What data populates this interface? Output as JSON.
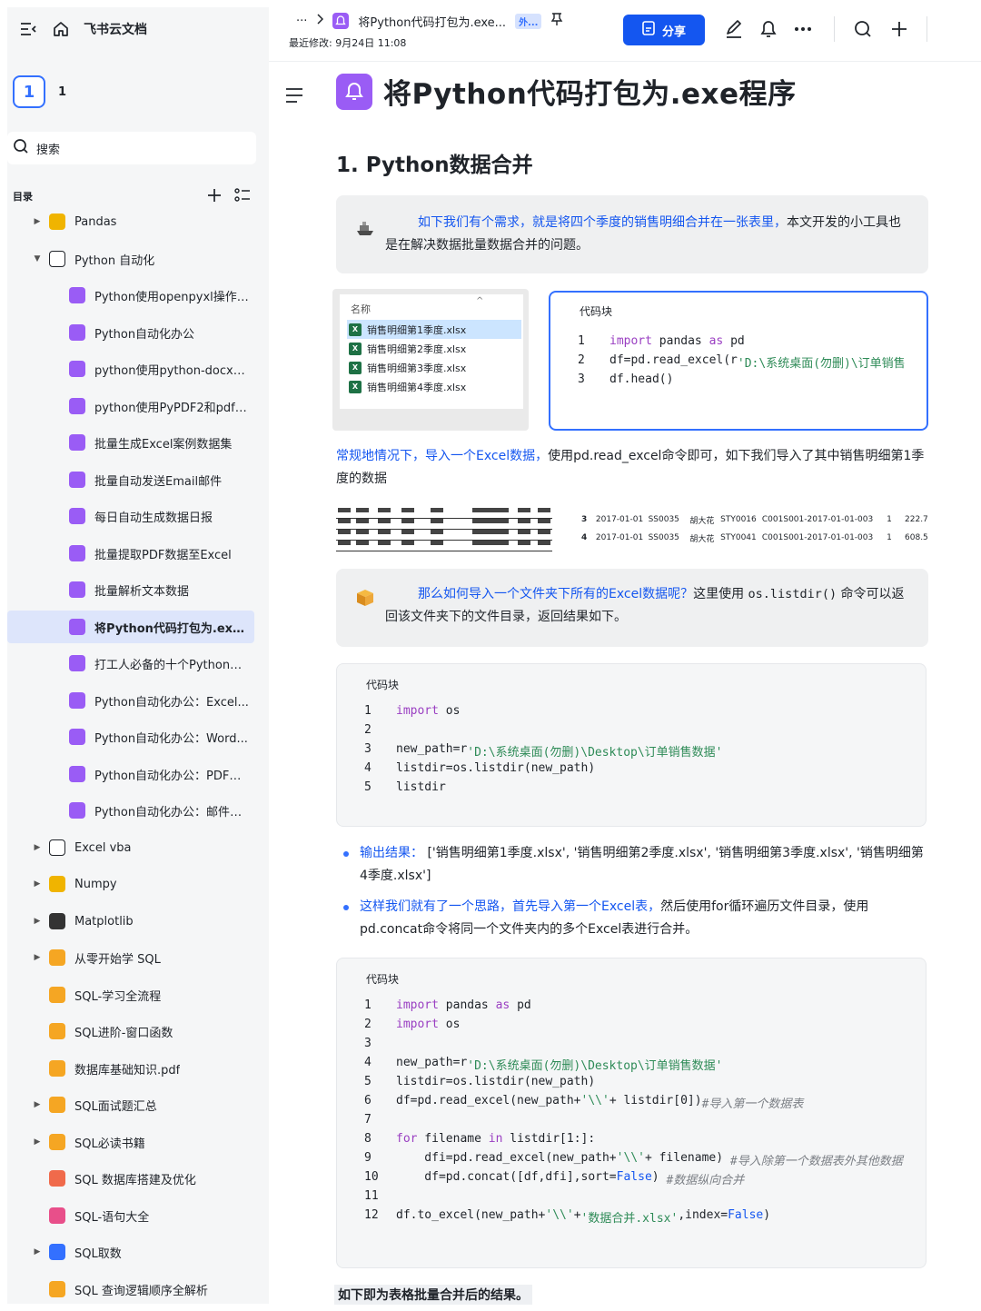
{
  "sidebar": {
    "brand": "飞书云文档",
    "user_badge": "1",
    "user_name": "1",
    "search_label": "搜索",
    "toc_label": "目录",
    "items": [
      {
        "label": "Pandas",
        "arrow": "right",
        "icon_color": "#f0b400"
      },
      {
        "label": "Python 自动化",
        "arrow": "down",
        "icon_color": "#ffffff"
      },
      {
        "label": "Python使用openpyxl操作e...",
        "icon_color": "#9a5cf5"
      },
      {
        "label": "Python自动化办公",
        "icon_color": "#9a5cf5"
      },
      {
        "label": "python使用python-docx操...",
        "icon_color": "#9a5cf5"
      },
      {
        "label": "python使用PyPDF2和pdfpl...",
        "icon_color": "#9a5cf5"
      },
      {
        "label": "批量生成Excel案例数据集",
        "icon_color": "#9a5cf5"
      },
      {
        "label": "批量自动发送Email邮件",
        "icon_color": "#9a5cf5"
      },
      {
        "label": "每日自动生成数据日报",
        "icon_color": "#9a5cf5"
      },
      {
        "label": "批量提取PDF数据至Excel",
        "icon_color": "#9a5cf5"
      },
      {
        "label": "批量解析文本数据",
        "icon_color": "#9a5cf5"
      },
      {
        "label": "将Python代码打包为.exe程序",
        "icon_color": "#9a5cf5",
        "active": true
      },
      {
        "label": "打工人必备的十个Python自...",
        "icon_color": "#9a5cf5"
      },
      {
        "label": "Python自动化办公：Excel...",
        "icon_color": "#9a5cf5"
      },
      {
        "label": "Python自动化办公：Word...",
        "icon_color": "#9a5cf5"
      },
      {
        "label": "Python自动化办公：PDF自...",
        "icon_color": "#9a5cf5"
      },
      {
        "label": "Python自动化办公：邮件自...",
        "icon_color": "#9a5cf5"
      },
      {
        "label": "Excel vba",
        "arrow": "right",
        "icon_color": "#ffffff"
      },
      {
        "label": "Numpy",
        "arrow": "right",
        "icon_color": "#f0b400"
      },
      {
        "label": "Matplotlib",
        "arrow": "right",
        "icon_color": "#333333"
      },
      {
        "label": "从零开始学 SQL",
        "arrow": "right",
        "icon_color": "#f5a623"
      },
      {
        "label": "SQL-学习全流程",
        "icon_color": "#f5a623"
      },
      {
        "label": "SQL进阶-窗口函数",
        "icon_color": "#f5a623"
      },
      {
        "label": "数据库基础知识.pdf",
        "icon_color": "#f5a623"
      },
      {
        "label": "SQL面试题汇总",
        "arrow": "right",
        "icon_color": "#f5a623"
      },
      {
        "label": "SQL必读书籍",
        "arrow": "right",
        "icon_color": "#f5a623"
      },
      {
        "label": "SQL 数据库搭建及优化",
        "icon_color": "#f06a4b"
      },
      {
        "label": "SQL-语句大全",
        "icon_color": "#e84f8a"
      },
      {
        "label": "SQL取数",
        "arrow": "right",
        "icon_color": "#3370ff"
      },
      {
        "label": "SQL 查询逻辑顺序全解析",
        "icon_color": "#f5a623"
      }
    ]
  },
  "topbar": {
    "ellipsis": "···",
    "doc_name": "将Python代码打包为.exe...",
    "tag": "外...",
    "modified": "最近修改: 9月24日 11:08",
    "share_label": "分享"
  },
  "doc": {
    "title": "将Python代码打包为.exe程序",
    "h2": "1. Python数据合并",
    "callout1_blue": "如下我们有个需求，就是将四个季度的销售明细合并在一张表里，",
    "callout1_rest": "本文开发的小工具也是在解决数据批量数据合并的问题。",
    "explorer": {
      "header": "名称",
      "files": [
        "销售明细第1季度.xlsx",
        "销售明细第2季度.xlsx",
        "销售明细第3季度.xlsx",
        "销售明细第4季度.xlsx"
      ]
    },
    "code1": {
      "label": "代码块",
      "lines": [
        {
          "n": "1",
          "parts": [
            {
              "t": "import",
              "c": "kw"
            },
            {
              "t": " pandas "
            },
            {
              "t": "as",
              "c": "kw"
            },
            {
              "t": " pd"
            }
          ]
        },
        {
          "n": "2",
          "parts": [
            {
              "t": "df=pd.read_excel(r"
            },
            {
              "t": "'D:\\系统桌面(勿删)\\订单销售",
              "c": "str"
            }
          ]
        },
        {
          "n": "3",
          "parts": [
            {
              "t": "df.head()"
            }
          ]
        }
      ]
    },
    "para1_blue": "常规地情况下，导入一个Excel数据，",
    "para1_rest": "使用pd.read_excel命令即可，如下我们导入了其中销售明细第1季度的数据",
    "snip_rows": [
      [
        "3",
        "2017-01-01",
        "SS0035",
        "胡大花",
        "STY0016",
        "C001S001-2017-01-01-003",
        "1",
        "222.7"
      ],
      [
        "4",
        "2017-01-01",
        "SS0035",
        "胡大花",
        "STY0041",
        "C001S001-2017-01-01-003",
        "1",
        "608.5"
      ]
    ],
    "callout2_blue": "那么如何导入一个文件夹下所有的Excel数据呢？",
    "callout2_mid": "这里使用 ",
    "callout2_code": "os.listdir()",
    "callout2_rest": " 命令可以返回该文件夹下的文件目录，返回结果如下。",
    "code2": {
      "label": "代码块",
      "lines": [
        {
          "n": "1",
          "parts": [
            {
              "t": "import",
              "c": "kw"
            },
            {
              "t": " os"
            }
          ]
        },
        {
          "n": "2",
          "parts": [
            {
              "t": ""
            }
          ]
        },
        {
          "n": "3",
          "parts": [
            {
              "t": "new_path=r"
            },
            {
              "t": "'D:\\系统桌面(勿删)\\Desktop\\订单销售数据'",
              "c": "str"
            }
          ]
        },
        {
          "n": "4",
          "parts": [
            {
              "t": "listdir=os.listdir(new_path)"
            }
          ]
        },
        {
          "n": "5",
          "parts": [
            {
              "t": "listdir"
            }
          ]
        }
      ]
    },
    "bullet1_blue": "输出结果：",
    "bullet1_rest": " ['销售明细第1季度.xlsx', '销售明细第2季度.xlsx', '销售明细第3季度.xlsx', '销售明细第4季度.xlsx']",
    "bullet2_blue": "这样我们就有了一个思路，首先导入第一个Excel表，",
    "bullet2_rest": "然后使用for循环遍历文件目录，使用pd.concat命令将同一个文件夹内的多个Excel表进行合并。",
    "code3": {
      "label": "代码块",
      "lines": [
        {
          "n": "1",
          "parts": [
            {
              "t": "import",
              "c": "kw"
            },
            {
              "t": " pandas "
            },
            {
              "t": "as",
              "c": "kw"
            },
            {
              "t": " pd"
            }
          ]
        },
        {
          "n": "2",
          "parts": [
            {
              "t": "import",
              "c": "kw"
            },
            {
              "t": " os"
            }
          ]
        },
        {
          "n": "3",
          "parts": [
            {
              "t": ""
            }
          ]
        },
        {
          "n": "4",
          "parts": [
            {
              "t": "new_path=r"
            },
            {
              "t": "'D:\\系统桌面(勿删)\\Desktop\\订单销售数据'",
              "c": "str"
            }
          ]
        },
        {
          "n": "5",
          "parts": [
            {
              "t": "listdir=os.listdir(new_path)"
            }
          ]
        },
        {
          "n": "6",
          "parts": [
            {
              "t": "df=pd.read_excel(new_path+"
            },
            {
              "t": "'\\\\'",
              "c": "str"
            },
            {
              "t": "+ listdir[0])"
            },
            {
              "t": "#导入第一个数据表",
              "c": "cmt"
            }
          ]
        },
        {
          "n": "7",
          "parts": [
            {
              "t": ""
            }
          ]
        },
        {
          "n": "8",
          "parts": [
            {
              "t": "for",
              "c": "kw"
            },
            {
              "t": " filename "
            },
            {
              "t": "in",
              "c": "kw"
            },
            {
              "t": " listdir[1:]:"
            }
          ]
        },
        {
          "n": "9",
          "parts": [
            {
              "t": "    dfi=pd.read_excel(new_path+"
            },
            {
              "t": "'\\\\'",
              "c": "str"
            },
            {
              "t": "+ filename) "
            },
            {
              "t": "#导入除第一个数据表外其他数据",
              "c": "cmt"
            }
          ]
        },
        {
          "n": "10",
          "parts": [
            {
              "t": "    df=pd.concat([df,dfi],sort="
            },
            {
              "t": "False",
              "c": "bool"
            },
            {
              "t": ") "
            },
            {
              "t": "#数据纵向合并",
              "c": "cmt"
            }
          ]
        },
        {
          "n": "11",
          "parts": [
            {
              "t": ""
            }
          ]
        },
        {
          "n": "12",
          "parts": [
            {
              "t": "df.to_excel(new_path+"
            },
            {
              "t": "'\\\\'",
              "c": "str"
            },
            {
              "t": "+"
            },
            {
              "t": "'数据合并.xlsx'",
              "c": "str"
            },
            {
              "t": ",index="
            },
            {
              "t": "False",
              "c": "bool"
            },
            {
              "t": ")"
            }
          ]
        }
      ]
    },
    "result_text": "如下即为表格批量合并后的结果。"
  },
  "colors": {
    "accent": "#1456f0",
    "doc_icon": "#9a5cf5",
    "active_item_bg": "#dde5fb"
  }
}
